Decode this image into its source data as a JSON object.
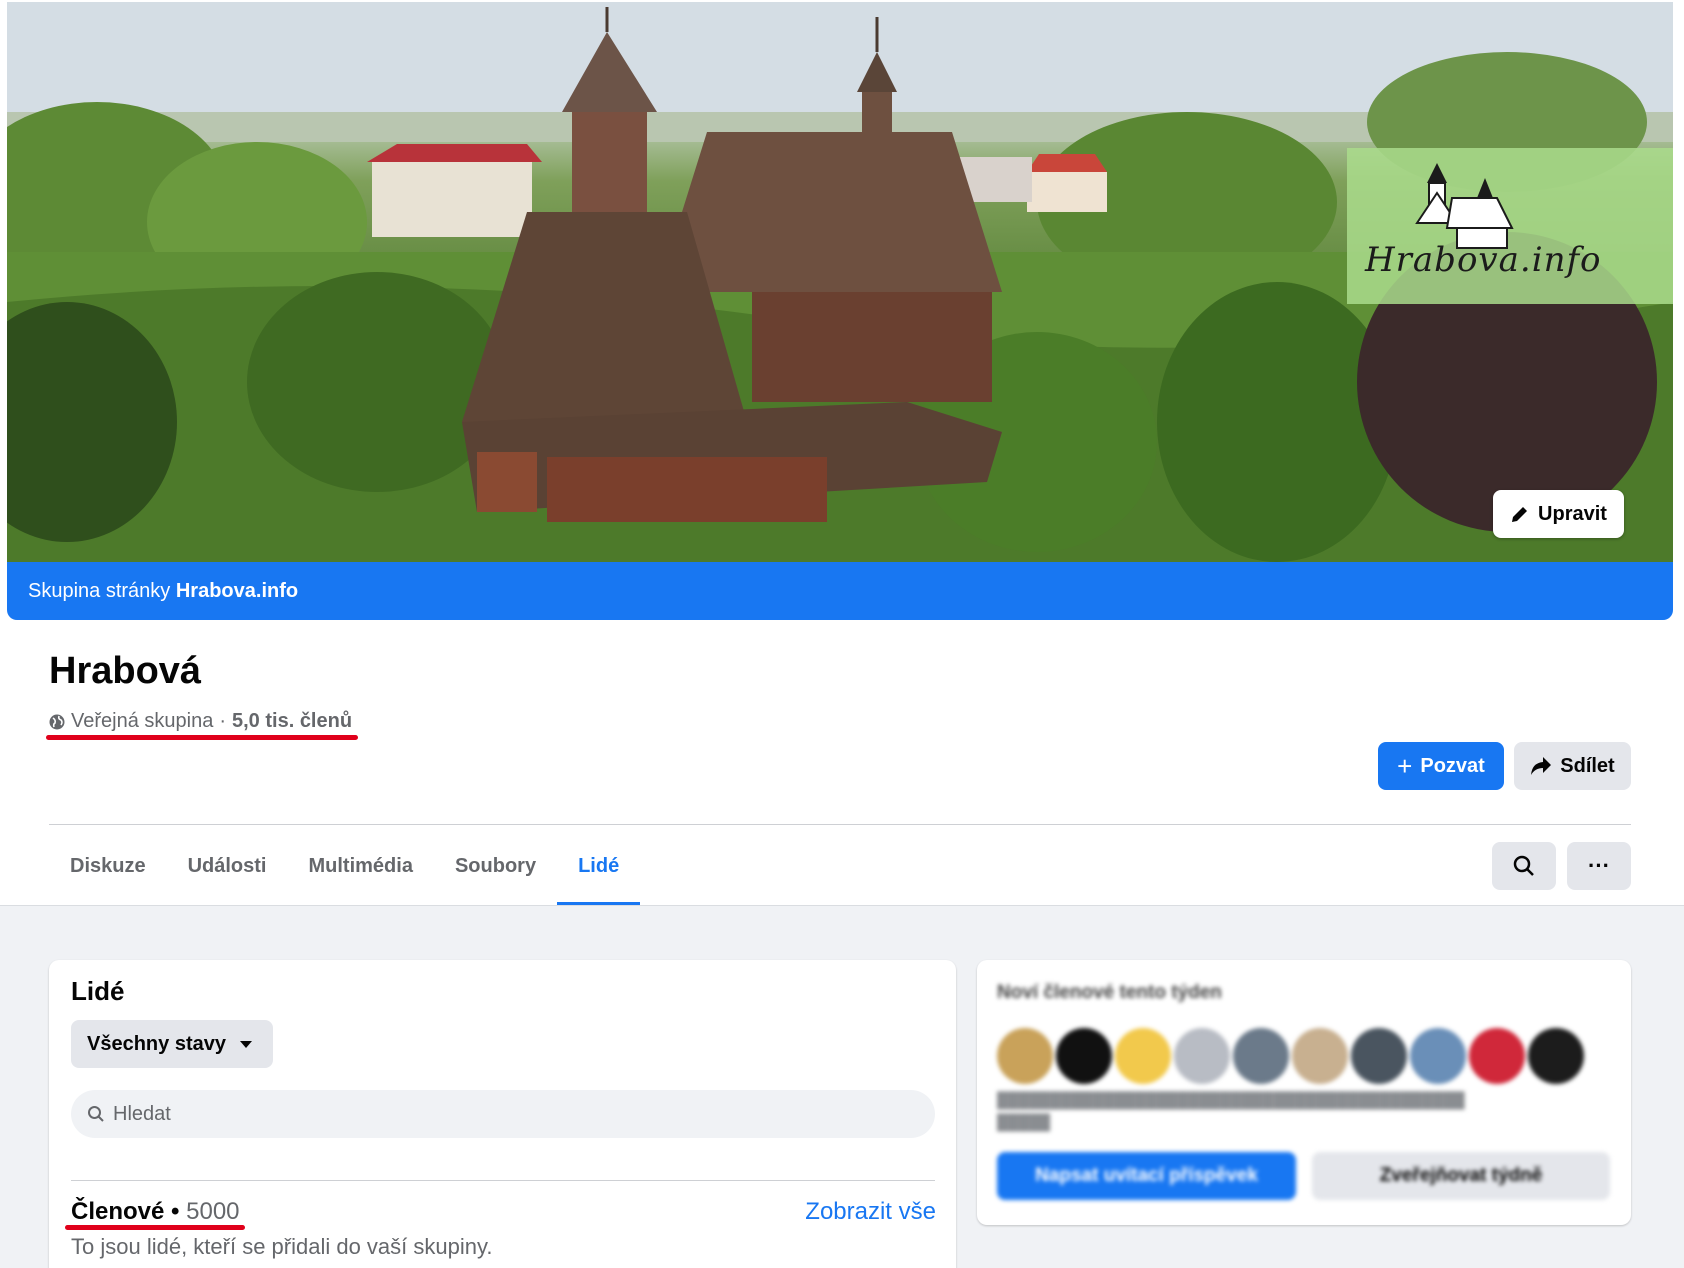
{
  "cover": {
    "banner_prefix": "Skupina stránky ",
    "banner_page": "Hrabova.info",
    "logo_text": "Hrabova.info",
    "edit_label": "Upravit"
  },
  "group": {
    "name": "Hrabová",
    "privacy": "Veřejná skupina",
    "separator": " · ",
    "members_short": "5,0 tis. členů",
    "invite_label": "Pozvat",
    "share_label": "Sdílet"
  },
  "tabs": [
    {
      "label": "Diskuze",
      "active": false
    },
    {
      "label": "Události",
      "active": false
    },
    {
      "label": "Multimédia",
      "active": false
    },
    {
      "label": "Soubory",
      "active": false
    },
    {
      "label": "Lidé",
      "active": true
    }
  ],
  "people": {
    "title": "Lidé",
    "filter_label": "Všechny stavy",
    "search_placeholder": "Hledat",
    "members_label": "Členové",
    "members_dot": " • ",
    "members_count": "5000",
    "see_all": "Zobrazit vše",
    "members_description": "To jsou lidé, kteří se přidali do vaší skupiny."
  },
  "new_members": {
    "title": "Noví členové tento týden",
    "welcome_label": "Napsat uvítací příspěvek",
    "weekly_label": "Zveřejňovat týdně",
    "avatar_colors": [
      "#c9a25a",
      "#111111",
      "#f2c94c",
      "#b8bcc4",
      "#6b7a8a",
      "#c8b090",
      "#4a5560",
      "#6a8fb8",
      "#d0283a",
      "#1c1c1c"
    ]
  },
  "colors": {
    "accent": "#1877f2",
    "annotation": "#e0001b"
  }
}
